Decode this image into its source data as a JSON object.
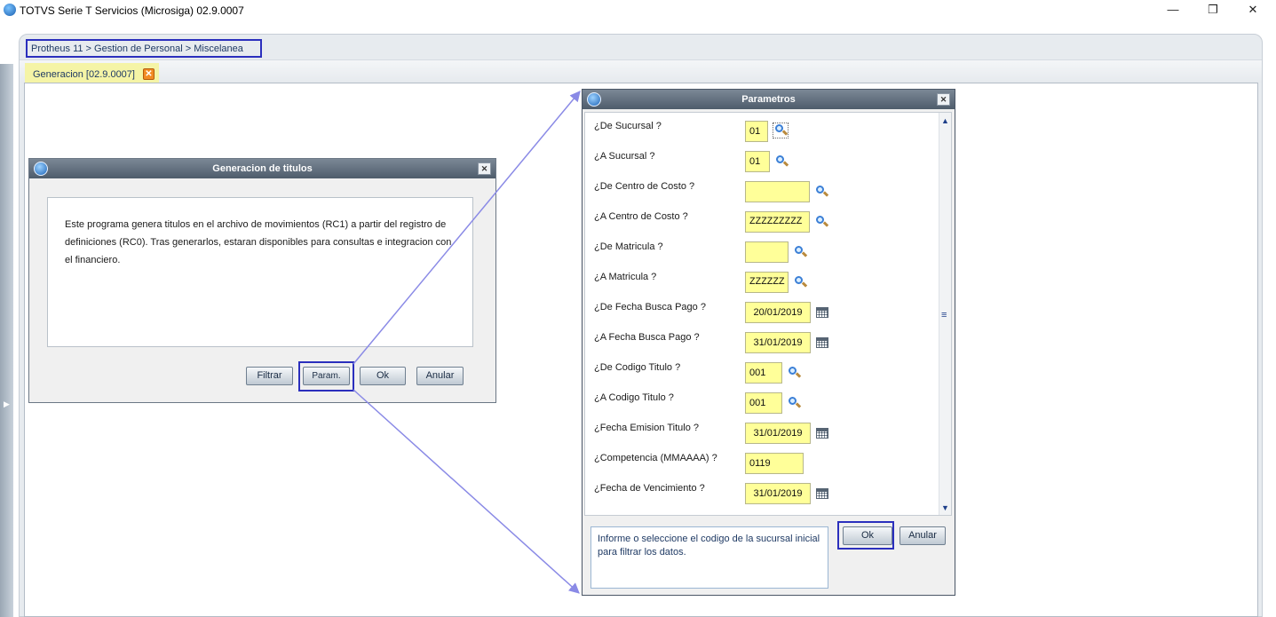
{
  "window": {
    "title": "TOTVS Serie T Servicios (Microsiga) 02.9.0007",
    "minimize_glyph": "—",
    "restore_glyph": "❐",
    "close_glyph": "✕"
  },
  "breadcrumb": "Protheus 11 > Gestion de Personal > Miscelanea",
  "tab": {
    "label": "Generacion [02.9.0007]",
    "close_glyph": "✕"
  },
  "gen_dialog": {
    "title": "Generacion de titulos",
    "description": "Este programa genera titulos en el  archivo  de  movimientos (RC1) a partir del registro de definiciones (RC0). Tras generarlos, estaran disponibles para consultas e integracion con el financiero.",
    "buttons": {
      "filtrar": "Filtrar",
      "param": "Param.",
      "ok": "Ok",
      "anular": "Anular"
    }
  },
  "param_dialog": {
    "title": "Parametros",
    "params": [
      {
        "label": "¿De Sucursal ?",
        "value": "01"
      },
      {
        "label": "¿A Sucursal ?",
        "value": "01"
      },
      {
        "label": "¿De Centro de Costo ?",
        "value": ""
      },
      {
        "label": "¿A Centro de Costo ?",
        "value": "ZZZZZZZZZ"
      },
      {
        "label": "¿De Matricula ?",
        "value": ""
      },
      {
        "label": "¿A Matricula ?",
        "value": "ZZZZZZ"
      },
      {
        "label": "¿De Fecha Busca Pago ?",
        "value": "20/01/2019"
      },
      {
        "label": "¿A Fecha Busca Pago ?",
        "value": "31/01/2019"
      },
      {
        "label": "¿De Codigo Titulo ?",
        "value": "001"
      },
      {
        "label": "¿A Codigo Titulo ?",
        "value": "001"
      },
      {
        "label": "¿Fecha Emision Titulo ?",
        "value": "31/01/2019"
      },
      {
        "label": "¿Competencia (MMAAAA) ?",
        "value": "0119"
      },
      {
        "label": "¿Fecha de Vencimiento ?",
        "value": "31/01/2019"
      }
    ],
    "help_text": "Informe o seleccione el codigo de la sucursal inicial para filtrar los datos.",
    "buttons": {
      "ok": "Ok",
      "anular": "Anular"
    }
  },
  "colors": {
    "input_fill": "#ffff99",
    "highlight_border": "#2b2fbd",
    "arrow": "#8a8ae6",
    "tab_active": "#f5f4a6",
    "dialog_title": "#5a6775"
  },
  "icons": [
    "app-logo-icon",
    "search-icon",
    "calendar-icon",
    "close-icon",
    "scroll-up-icon",
    "scroll-down-icon"
  ]
}
